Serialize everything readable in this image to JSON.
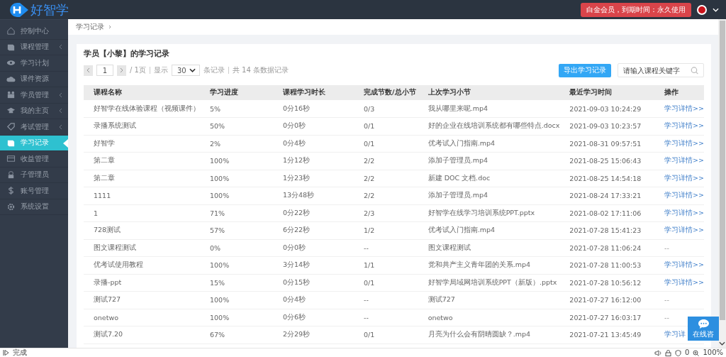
{
  "header": {
    "logo_text": "好智学",
    "membership_badge": "白金会员，到期时间：永久使用"
  },
  "sidebar": {
    "items": [
      {
        "label": "控制中心",
        "expandable": false,
        "selected": false
      },
      {
        "label": "课程管理",
        "expandable": true,
        "selected": false
      },
      {
        "label": "学习计划",
        "expandable": false,
        "selected": false
      },
      {
        "label": "课件资源",
        "expandable": false,
        "selected": false
      },
      {
        "label": "学员管理",
        "expandable": true,
        "selected": false
      },
      {
        "label": "我的主页",
        "expandable": true,
        "selected": false
      },
      {
        "label": "考试管理",
        "expandable": true,
        "selected": false
      },
      {
        "label": "学习记录",
        "expandable": false,
        "selected": true
      },
      {
        "label": "收益管理",
        "expandable": false,
        "selected": false
      },
      {
        "label": "子管理员",
        "expandable": false,
        "selected": false
      },
      {
        "label": "账号管理",
        "expandable": false,
        "selected": false
      },
      {
        "label": "系统设置",
        "expandable": false,
        "selected": false
      }
    ]
  },
  "breadcrumb": "学习记录",
  "card": {
    "title": "学员【小黎】的学习记录",
    "pagination": {
      "page": "1",
      "pages_text": "/ 1页",
      "show_label": "显示",
      "page_size": "30",
      "records_label": "条记录",
      "total_text": "共 14 条数据记录"
    },
    "export_button": "导出学习记录",
    "search": {
      "placeholder": "请输入课程关键字"
    },
    "table": {
      "columns": [
        "课程名称",
        "学习进度",
        "课程学习时长",
        "完成节数/总小节",
        "上次学习小节",
        "最近学习时间",
        "操作"
      ],
      "rows": [
        {
          "cells": [
            "好智学在线体验课程（视频课件）",
            "5%",
            "0分16秒",
            "0/3",
            "我从哪里来呢.mp4",
            "2021-09-03 10:24:29"
          ],
          "action": {
            "kind": "link",
            "label": "学习详情>>"
          }
        },
        {
          "cells": [
            "录播系统测试",
            "50%",
            "0分0秒",
            "0/1",
            "好的企业在线培训系统都有哪些特点.docx",
            "2021-09-03 10:23:57"
          ],
          "action": {
            "kind": "link",
            "label": "学习详情>>"
          }
        },
        {
          "cells": [
            "好智学",
            "2%",
            "0分4秒",
            "0/1",
            "优考试入门指南.mp4",
            "2021-08-31 09:57:51"
          ],
          "action": {
            "kind": "link",
            "label": "学习详情>>"
          }
        },
        {
          "cells": [
            "第二章",
            "100%",
            "1分12秒",
            "2/2",
            "添加子管理员.mp4",
            "2021-08-25 15:06:43"
          ],
          "action": {
            "kind": "link",
            "label": "学习详情>>"
          }
        },
        {
          "cells": [
            "第二章",
            "100%",
            "1分23秒",
            "2/2",
            "新建 DOC 文档.doc",
            "2021-08-25 14:54:18"
          ],
          "action": {
            "kind": "link",
            "label": "学习详情>>"
          }
        },
        {
          "cells": [
            "1111",
            "100%",
            "13分48秒",
            "2/2",
            "添加子管理员.mp4",
            "2021-08-24 17:33:21"
          ],
          "action": {
            "kind": "link",
            "label": "学习详情>>"
          }
        },
        {
          "cells": [
            "1",
            "71%",
            "0分22秒",
            "2/3",
            "好智学在线学习培训系统PPT.pptx",
            "2021-08-02 17:11:06"
          ],
          "action": {
            "kind": "link",
            "label": "学习详情>>"
          }
        },
        {
          "cells": [
            "728测试",
            "57%",
            "6分22秒",
            "1/2",
            "优考试入门指南.mp4",
            "2021-07-28 15:41:23"
          ],
          "action": {
            "kind": "link",
            "label": "学习详情>>"
          }
        },
        {
          "cells": [
            "图文课程测试",
            "0%",
            "0分0秒",
            "--",
            "图文课程测试",
            "2021-07-28 11:06:24"
          ],
          "action": {
            "kind": "text",
            "label": "--"
          }
        },
        {
          "cells": [
            "优考试使用教程",
            "100%",
            "3分14秒",
            "1/1",
            "党和共产主义青年团的关系.mp4",
            "2021-07-28 11:00:53"
          ],
          "action": {
            "kind": "link",
            "label": "学习详情>>"
          }
        },
        {
          "cells": [
            "录播-ppt",
            "15%",
            "0分15秒",
            "0/1",
            "好智学局域网培训系统PPT（新版）.pptx",
            "2021-07-28 10:56:12"
          ],
          "action": {
            "kind": "link",
            "label": "学习详情>>"
          }
        },
        {
          "cells": [
            "测试727",
            "100%",
            "0分4秒",
            "--",
            "测试727",
            "2021-07-27 16:12:00"
          ],
          "action": {
            "kind": "text",
            "label": "--"
          }
        },
        {
          "cells": [
            "onetwo",
            "100%",
            "0分6秒",
            "--",
            "onetwo",
            "2021-07-27 16:03:17"
          ],
          "action": {
            "kind": "text",
            "label": "--"
          }
        },
        {
          "cells": [
            "测试7.20",
            "67%",
            "2分29秒",
            "0/1",
            "月亮为什么会有阴晴圆缺？.mp4",
            "2021-07-21 13:45:49"
          ],
          "action": {
            "kind": "link",
            "label": "学习详"
          }
        }
      ]
    }
  },
  "chat_widget": {
    "label": "在线咨"
  },
  "status_bar": {
    "status": "完成",
    "counter": "0",
    "zoom": "100%"
  }
}
